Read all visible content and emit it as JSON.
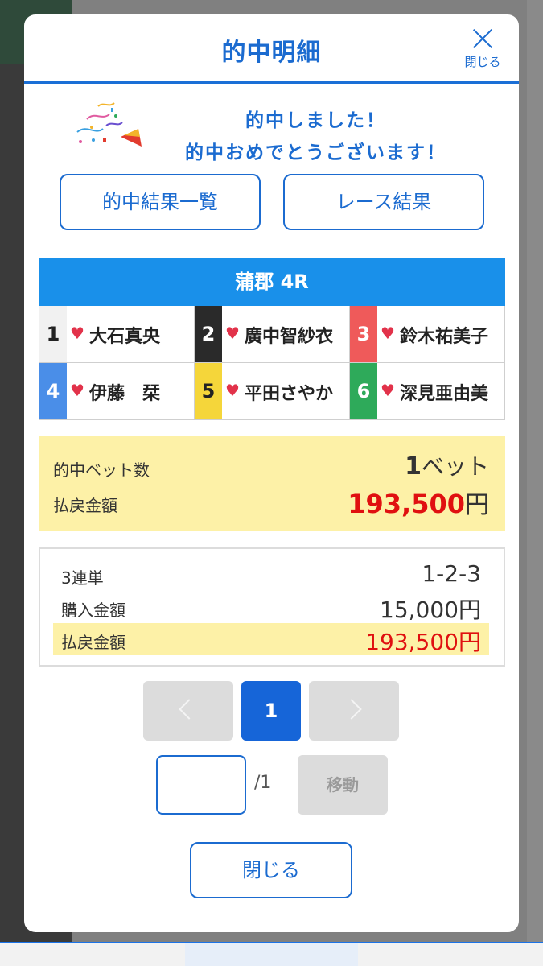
{
  "modal": {
    "title": "的中明細",
    "close_label": "閉じる"
  },
  "congrats": {
    "line1": "的中しました！",
    "line2": "的中おめでとうございます！"
  },
  "buttons": {
    "results_list": "的中結果一覧",
    "race_results": "レース結果"
  },
  "race": {
    "title": "蒲郡 4R",
    "racers": [
      {
        "num": "1",
        "name": "大石真央",
        "bg": "#f1f1f1",
        "fg": "#222222"
      },
      {
        "num": "2",
        "name": "廣中智紗衣",
        "bg": "#2a2a2a",
        "fg": "#ffffff"
      },
      {
        "num": "3",
        "name": "鈴木祐美子",
        "bg": "#ef5a5a",
        "fg": "#ffffff"
      },
      {
        "num": "4",
        "name": "伊藤　栞",
        "bg": "#4a8ee8",
        "fg": "#ffffff"
      },
      {
        "num": "5",
        "name": "平田さやか",
        "bg": "#f5d63a",
        "fg": "#222222"
      },
      {
        "num": "6",
        "name": "深見亜由美",
        "bg": "#2eaa5a",
        "fg": "#ffffff"
      }
    ]
  },
  "summary": {
    "bets_label": "的中ベット数",
    "bets_count": "1",
    "bets_unit": "ベット",
    "payout_label": "払戻金額",
    "payout_amount": "193,500",
    "payout_unit": "円"
  },
  "detail": {
    "bet_type_label": "3連単",
    "bet_combo": "1-2-3",
    "purchase_label": "購入金額",
    "purchase_amount": "15,000円",
    "payout_label": "払戻金額",
    "payout_amount": "193,500円"
  },
  "pagination": {
    "current_page": "1",
    "total": "/1",
    "move_label": "移動",
    "input_value": ""
  },
  "footer": {
    "close_label": "閉じる"
  },
  "colors": {
    "accent": "#1b6bd0",
    "race_header": "#1990ea",
    "summary_bg": "#fdf1a7",
    "payout_red": "#e01010"
  }
}
